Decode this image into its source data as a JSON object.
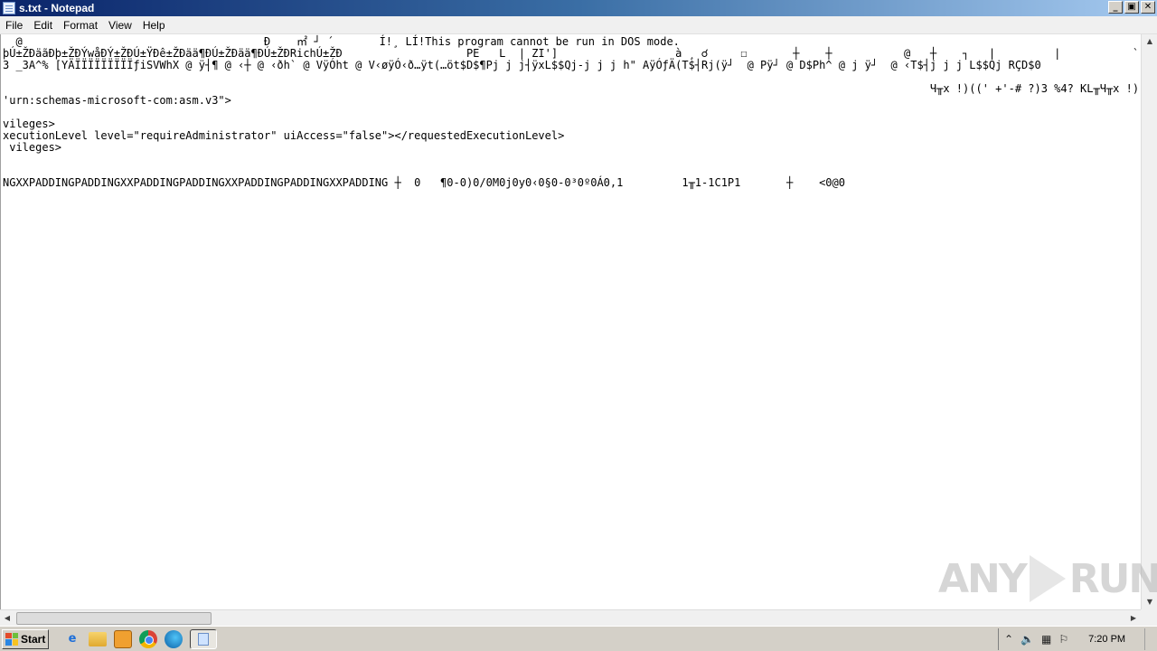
{
  "window": {
    "title": "s.txt - Notepad",
    "controls": {
      "minimize": "_",
      "maximize": "▣",
      "close": "✕"
    }
  },
  "menu": {
    "items": [
      "File",
      "Edit",
      "Format",
      "View",
      "Help"
    ]
  },
  "editor": {
    "lines": [
      "  @                                     Ð    ㎡ ┘ ´       Í!¸ LÍ!This program cannot be run in DOS mode.",
      "þÚ±ŽÐäãÐþ±ŽÐÝwåÐÝ±ŽÐÚ±ŸÐê±ŽÐää¶ÐÚ±ŽÐää¶ÐÚ±ŽÐRichÚ±ŽÐ                   PE   L  | ZI']                  à ¸ ☌     ☐       ┼    ┼           @   ┼    ┐   |         |           `     ┘   þ/   ┐ @..",
      "3 _3A^% [YÄÏÏÏÏÏÏÏÏÏƒiSVWhX @ ÿ┤¶ @ ‹┼ @ ‹ðh` @ VÿÓht @ V‹øÿÓ‹ð…ÿt(…öt$D$¶Pj j j┤ÿxL$$Qj-j j j h\" AÿÓƒÄ(T$┤Rj(ÿ┘  @ Pÿ┘ @ D$Ph^ @ j ÿ┘  @ ‹T$┤j j j L$$Qj RÇD$0",
      "                                                                                                                                              Ч╥x !)((' +'-# ?)3 %4? KL╥Ч╥x !)((' 5'? !))\"$",
      "'urn:schemas-microsoft-com:asm.v3\">",
      "",
      "vileges>",
      "xecutionLevel level=\"requireAdministrator\" uiAccess=\"false\"></requestedExecutionLevel>",
      " vileges>",
      "",
      "",
      "",
      "NGXXPADDINGPADDINGXXPADDINGPADDINGXXPADDINGPADDINGXXPADDING ┼  0   ¶0-0)0/0M0j0y0‹0§0-0³0º0Á0,1         1╥1-1C1P1       ┼    <0@0"
    ]
  },
  "watermark": {
    "text": "ANY",
    "text2": "RUN"
  },
  "taskbar": {
    "start_label": "Start",
    "clock": "7:20 PM",
    "tray_icons": [
      "chevron-up-icon",
      "speaker-icon",
      "network-icon",
      "flag-icon"
    ]
  }
}
